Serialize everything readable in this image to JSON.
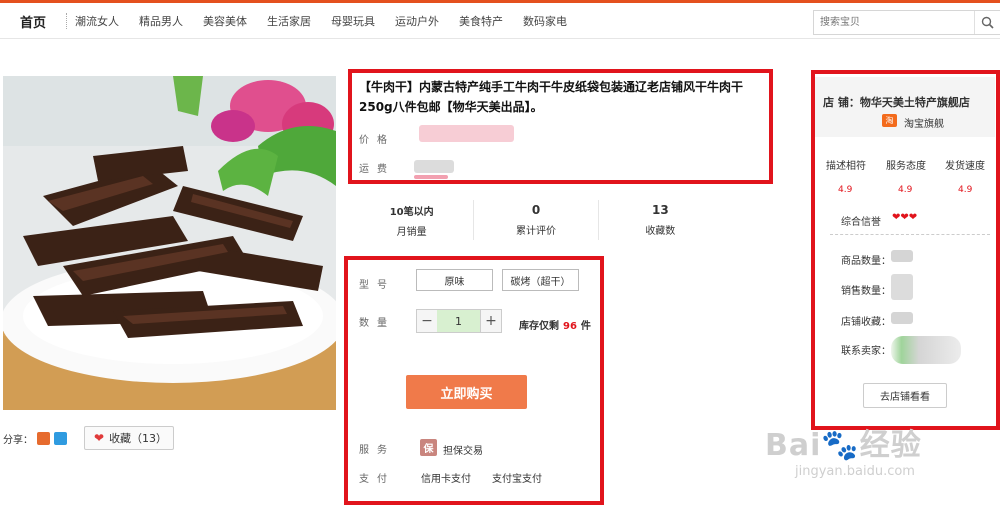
{
  "nav": {
    "home": "首页",
    "items": [
      "潮流女人",
      "精品男人",
      "美容美体",
      "生活家居",
      "母婴玩具",
      "运动户外",
      "美食特产",
      "数码家电"
    ],
    "search_placeholder": "搜索宝贝",
    "search_icon": "search-icon"
  },
  "product": {
    "title": "【牛肉干】内蒙古特产纯手工牛肉干牛皮纸袋包装通辽老店铺风干牛肉干250g八件包邮【物华天美出品】。",
    "price_label": "价格",
    "shipping_label": "运费"
  },
  "stats": [
    {
      "value": "10笔以内",
      "label": "月销量"
    },
    {
      "value": "0",
      "label": "累计评价"
    },
    {
      "value": "13",
      "label": "收藏数"
    }
  ],
  "options": {
    "type_label": "型号",
    "type_values": [
      "原味",
      "碳烤（超干）"
    ],
    "qty_label": "数量",
    "qty_minus": "−",
    "qty_value": "1",
    "qty_plus": "+",
    "stock_prefix": "库存仅剩",
    "stock_count": "96",
    "stock_unit": "件",
    "buy_label": "立即购买",
    "service_label": "服务",
    "guarantee_icon_text": "保",
    "service_value": "担保交易",
    "pay_label": "支付",
    "pay_methods": [
      "信用卡支付",
      "支付宝支付"
    ]
  },
  "share": {
    "label": "分享：",
    "fav_label": "收藏（13）"
  },
  "shop": {
    "label": "店 铺：",
    "name": "物华天美土特产旗舰店",
    "taobao_icon_text": "淘",
    "platform": "淘宝旗舰",
    "ratings": [
      {
        "label": "描述相符",
        "value": "4.9"
      },
      {
        "label": "服务态度",
        "value": "4.9"
      },
      {
        "label": "发货速度",
        "value": "4.9"
      }
    ],
    "credit_label": "综合信誉",
    "credit_hearts": "❤❤❤",
    "info_labels": [
      "商品数量：",
      "销售数量：",
      "店铺收藏：",
      "联系卖家："
    ],
    "goto_label": "去店铺看看"
  },
  "watermark": {
    "big": "Bai🐾经验",
    "small": "jingyan.baidu.com"
  },
  "colors": {
    "accent": "#e4501e",
    "highlight_box": "#e1141c",
    "buy_button": "#f07a4a"
  }
}
